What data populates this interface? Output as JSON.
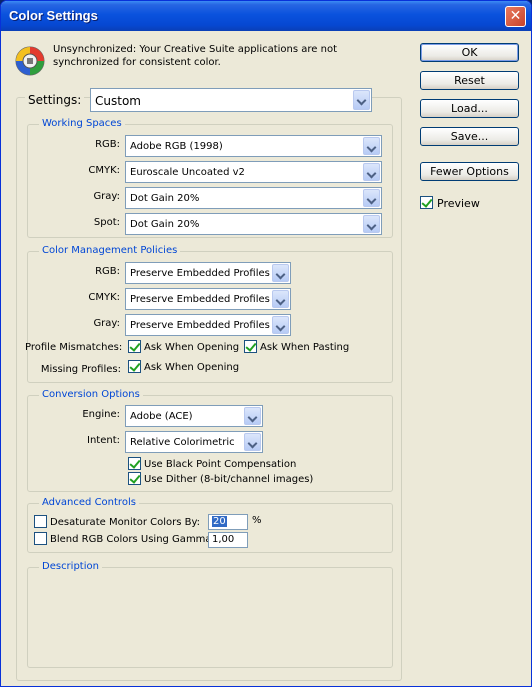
{
  "window": {
    "title": "Color Settings",
    "close_symbol": "✕"
  },
  "sync": {
    "icon": "color-sync-icon",
    "message": "Unsynchronized: Your Creative Suite applications are not synchronized for consistent color."
  },
  "buttons": {
    "ok": "OK",
    "reset": "Reset",
    "load": "Load...",
    "save": "Save...",
    "fewer_options": "Fewer Options"
  },
  "preview": {
    "label": "Preview",
    "checked": true
  },
  "settings": {
    "label": "Settings:",
    "value": "Custom"
  },
  "working_spaces": {
    "title": "Working Spaces",
    "rgb": {
      "label": "RGB:",
      "value": "Adobe RGB (1998)"
    },
    "cmyk": {
      "label": "CMYK:",
      "value": "Euroscale Uncoated v2"
    },
    "gray": {
      "label": "Gray:",
      "value": "Dot Gain 20%"
    },
    "spot": {
      "label": "Spot:",
      "value": "Dot Gain 20%"
    }
  },
  "policies": {
    "title": "Color Management Policies",
    "rgb": {
      "label": "RGB:",
      "value": "Preserve Embedded Profiles"
    },
    "cmyk": {
      "label": "CMYK:",
      "value": "Preserve Embedded Profiles"
    },
    "gray": {
      "label": "Gray:",
      "value": "Preserve Embedded Profiles"
    },
    "profile_mismatches_label": "Profile Mismatches:",
    "ask_opening": "Ask When Opening",
    "ask_pasting": "Ask When Pasting",
    "missing_profiles_label": "Missing Profiles:",
    "missing_ask_opening": "Ask When Opening"
  },
  "conversion": {
    "title": "Conversion Options",
    "engine": {
      "label": "Engine:",
      "value": "Adobe (ACE)"
    },
    "intent": {
      "label": "Intent:",
      "value": "Relative Colorimetric"
    },
    "black_point": "Use Black Point Compensation",
    "dither": "Use Dither (8-bit/channel images)"
  },
  "advanced": {
    "title": "Advanced Controls",
    "desaturate_label": "Desaturate Monitor Colors By:",
    "desaturate_value": "20",
    "percent": "%",
    "blend_label": "Blend RGB Colors Using Gamma:",
    "blend_value": "1,00"
  },
  "description": {
    "title": "Description"
  }
}
